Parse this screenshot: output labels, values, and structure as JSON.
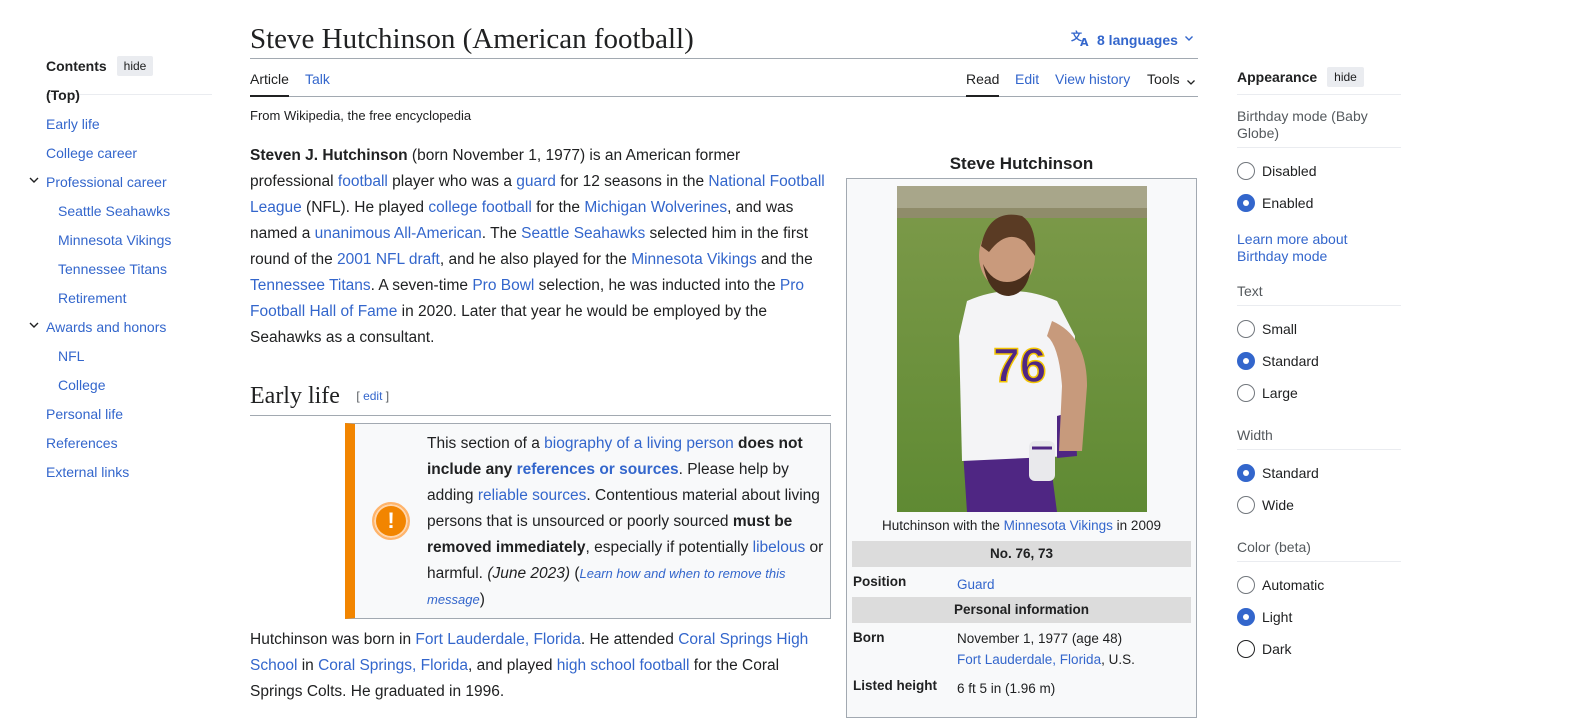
{
  "page": {
    "title": "Steve Hutchinson (American football)",
    "languages_label": "8 languages",
    "tagline": "From Wikipedia, the free encyclopedia"
  },
  "tabs": {
    "article": "Article",
    "talk": "Talk",
    "read": "Read",
    "edit": "Edit",
    "history": "View history",
    "tools": "Tools"
  },
  "toc": {
    "title": "Contents",
    "hide": "hide",
    "items": [
      {
        "label": "(Top)"
      },
      {
        "label": "Early life"
      },
      {
        "label": "College career"
      },
      {
        "label": "Professional career"
      },
      {
        "label": "Seattle Seahawks"
      },
      {
        "label": "Minnesota Vikings"
      },
      {
        "label": "Tennessee Titans"
      },
      {
        "label": "Retirement"
      },
      {
        "label": "Awards and honors"
      },
      {
        "label": "NFL"
      },
      {
        "label": "College"
      },
      {
        "label": "Personal life"
      },
      {
        "label": "References"
      },
      {
        "label": "External links"
      }
    ]
  },
  "lead": {
    "name": "Steven J. Hutchinson",
    "t1": " (born November 1, 1977) is an American former professional ",
    "l_football": "football",
    "t2": " player who was a ",
    "l_guard": "guard",
    "t3": " for 12 seasons in the ",
    "l_nfl": "National Football League",
    "t4": " (NFL). He played ",
    "l_college_football": "college football",
    "t5": " for the ",
    "l_michigan": "Michigan Wolverines",
    "t6": ", and was named a ",
    "l_unanimous": "unanimous All-American",
    "t7": ". The ",
    "l_seahawks": "Seattle Seahawks",
    "t8": " selected him in the first round of the ",
    "l_draft": "2001 NFL draft",
    "t9": ", and he also played for the ",
    "l_vikings": "Minnesota Vikings",
    "t10": " and the ",
    "l_titans": "Tennessee Titans",
    "t11": ". A seven-time ",
    "l_probowl": "Pro Bowl",
    "t12": " selection, he was inducted into the ",
    "l_hof": "Pro Football Hall of Fame",
    "t13": " in 2020. Later that year he would be employed by the Seahawks as a consultant."
  },
  "early_life": {
    "heading": "Early life",
    "edit_open": "[ ",
    "edit": "edit",
    "edit_close": " ]",
    "p1": "Hutchinson was born in ",
    "l_ftl": "Fort Lauderdale, Florida",
    "p2": ". He attended ",
    "l_cshs": "Coral Springs High School",
    "p3": " in ",
    "l_cs": "Coral Springs, Florida",
    "p4": ", and played ",
    "l_hsf": "high school football",
    "p5": " for the Coral Springs Colts. He graduated in 1996."
  },
  "ambox": {
    "icon": "!",
    "a1": "This section of a ",
    "l_blp": "biography of a living person",
    "b1": " does not include",
    "a2": " any ",
    "l_refs": "references or sources",
    "a3": ". Please help by adding ",
    "l_reliable": "reliable sources",
    "a4": ". Contentious material about living persons that is unsourced or poorly sourced ",
    "b2": "must be removed immediately",
    "a5": ", especially if potentially ",
    "l_libelous": "libelous",
    "a6": " or harmful. ",
    "date": "(June 2023)",
    "a7": " (",
    "l_learn": "Learn how and when to remove this message",
    "a8": ")"
  },
  "infobox": {
    "title": "Steve Hutchinson",
    "caption_pre": "Hutchinson with the ",
    "caption_link": "Minnesota Vikings",
    "caption_post": " in 2009",
    "jersey_number": "76",
    "number": "No. 76, 73",
    "position_label": "Position",
    "position_value": "Guard",
    "personal_header": "Personal information",
    "born_label": "Born",
    "born_value": "November 1, 1977 (age 48)",
    "born_place": "Fort Lauderdale, Florida",
    "born_country": ", U.S.",
    "height_label": "Listed height",
    "height_value": "6 ft 5 in (1.96 m)"
  },
  "appearance": {
    "title": "Appearance",
    "hide": "hide",
    "birthday_label": "Birthday mode (Baby Globe)",
    "birthday_options": [
      "Disabled",
      "Enabled"
    ],
    "birthday_selected": "Enabled",
    "learn_more": "Learn more about Birthday mode",
    "text_label": "Text",
    "text_options": [
      "Small",
      "Standard",
      "Large"
    ],
    "text_selected": "Standard",
    "width_label": "Width",
    "width_options": [
      "Standard",
      "Wide"
    ],
    "width_selected": "Standard",
    "color_label": "Color (beta)",
    "color_options": [
      "Automatic",
      "Light",
      "Dark"
    ],
    "color_selected": "Light"
  },
  "colors": {
    "link": "#3366cc",
    "ambox_stripe": "#f28500",
    "text": "#202122",
    "vikings_purple": "#4f2683"
  }
}
